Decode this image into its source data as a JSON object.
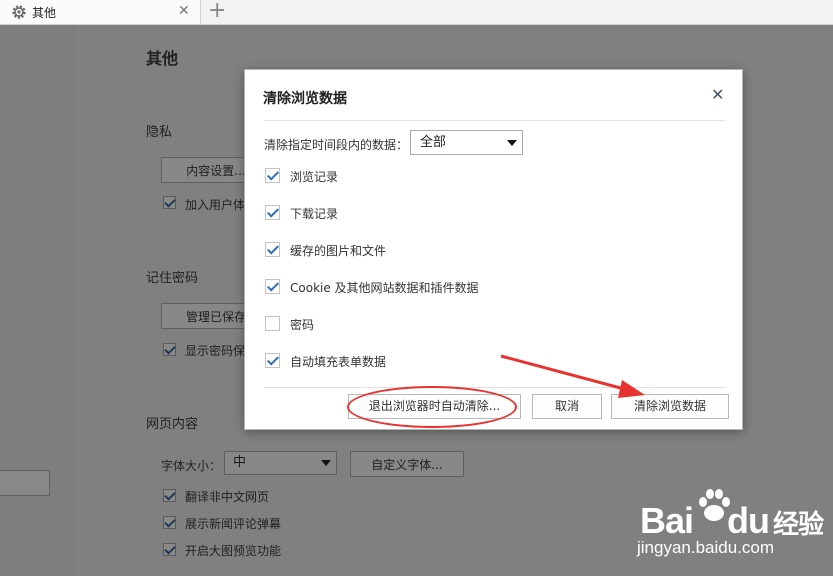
{
  "tab": {
    "title": "其他",
    "icon": "gear-icon"
  },
  "settings": {
    "page_title": "其他",
    "privacy": {
      "title": "隐私",
      "content_settings_button": "内容设置...",
      "join_user_program_label": "加入用户体"
    },
    "passwords": {
      "title": "记住密码",
      "manage_saved_button": "管理已保存",
      "show_password_label": "显示密码保"
    },
    "web_content": {
      "title": "网页内容",
      "font_size_label": "字体大小：",
      "font_size_value": "中",
      "custom_fonts_button": "自定义字体...",
      "options": [
        {
          "label": "翻译非中文网页",
          "checked": true
        },
        {
          "label": "展示新闻评论弹幕",
          "checked": true
        },
        {
          "label": "开启大图预览功能",
          "checked": true
        }
      ]
    }
  },
  "dialog": {
    "title": "清除浏览数据",
    "close_icon": "close-icon",
    "range_label": "清除指定时间段内的数据：",
    "range_value": "全部",
    "options": [
      {
        "label": "浏览记录",
        "checked": true
      },
      {
        "label": "下载记录",
        "checked": true
      },
      {
        "label": "缓存的图片和文件",
        "checked": true
      },
      {
        "label": "Cookie 及其他网站数据和插件数据",
        "checked": true
      },
      {
        "label": "密码",
        "checked": false
      },
      {
        "label": "自动填充表单数据",
        "checked": true
      }
    ],
    "buttons": {
      "auto_clear": "退出浏览器时自动清除...",
      "cancel": "取消",
      "clear": "清除浏览数据"
    }
  },
  "annotation_color": "#e8322f",
  "watermark": {
    "brand_a": "Bai",
    "brand_b": "du",
    "brand_c": "经验",
    "url": "jingyan.baidu.com"
  }
}
